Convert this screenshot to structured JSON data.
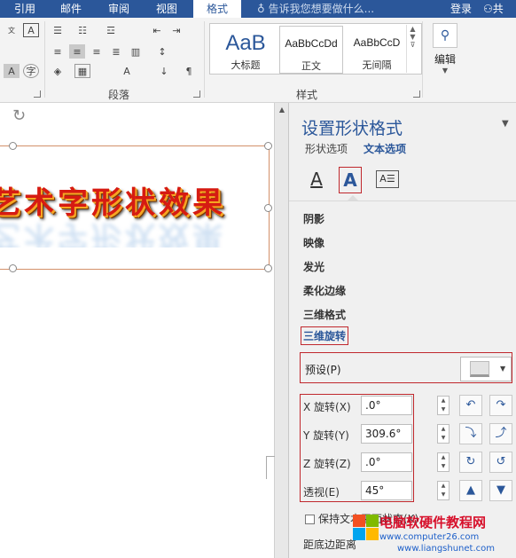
{
  "ribbon_tabs": [
    "引用",
    "邮件",
    "审阅",
    "视图",
    "格式"
  ],
  "active_tab": "格式",
  "tell_me": "告诉我您想要做什么...",
  "login": "登录",
  "share": "共",
  "groups": {
    "paragraph": "段落",
    "styles": "样式",
    "editing": "编辑"
  },
  "styles_gallery": [
    {
      "sample": "AaB",
      "name": "大标题"
    },
    {
      "sample": "AaBbCcDd",
      "name": "正文"
    },
    {
      "sample": "AaBbCcD",
      "name": "无间隔"
    }
  ],
  "selected_style": "正文",
  "wordart_text": "艺术字形状效果",
  "pane": {
    "title": "设置形状格式",
    "tab_shape": "形状选项",
    "tab_text": "文本选项",
    "icon_fill": "A",
    "icon_effects": "A",
    "icon_layout": "A☰",
    "sections": [
      "阴影",
      "映像",
      "发光",
      "柔化边缘",
      "三维格式",
      "三维旋转"
    ],
    "active_section": "三维旋转",
    "preset_label": "预设(P)",
    "rotation": [
      {
        "label": "X 旋转(X)",
        "value": ".0°"
      },
      {
        "label": "Y 旋转(Y)",
        "value": "309.6°"
      },
      {
        "label": "Z 旋转(Z)",
        "value": ".0°"
      },
      {
        "label": "透视(E)",
        "value": "45°"
      }
    ],
    "keep_text_flat": "保持文本平面状态(K)",
    "distance_from_ground": "距底边距离"
  },
  "watermark": {
    "title": "电脑软硬件教程网",
    "url1": "www.computer26.com",
    "url2": "www.liangshunet.com"
  },
  "colors": {
    "accent": "#2b579a",
    "highlight": "#c0282d",
    "wordart": "#d61b12"
  }
}
